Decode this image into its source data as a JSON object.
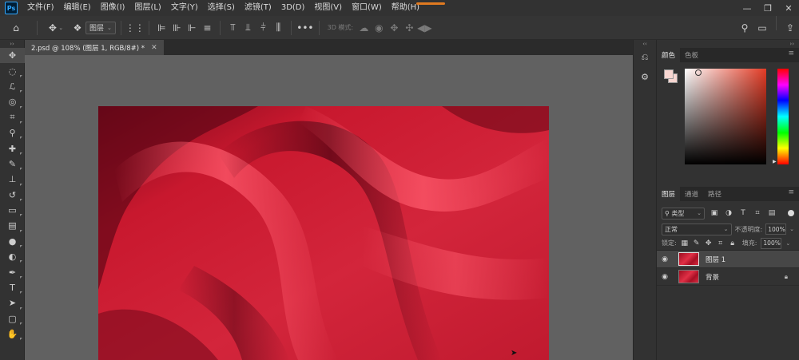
{
  "app": {
    "logo_text": "Ps"
  },
  "menu": [
    "文件(F)",
    "编辑(E)",
    "图像(I)",
    "图层(L)",
    "文字(Y)",
    "选择(S)",
    "滤镜(T)",
    "3D(D)",
    "视图(V)",
    "窗口(W)",
    "帮助(H)"
  ],
  "window_controls": {
    "minimize": "—",
    "restore": "❐",
    "close": "✕"
  },
  "options_bar": {
    "layer_select": "图层",
    "mode_3d_label": "3D 模式:"
  },
  "tools": [
    {
      "name": "move-tool",
      "glyph": "✥"
    },
    {
      "name": "marquee-tool",
      "glyph": "◌"
    },
    {
      "name": "lasso-tool",
      "glyph": "ℒ"
    },
    {
      "name": "quick-select-tool",
      "glyph": "◎"
    },
    {
      "name": "crop-tool",
      "glyph": "⌗"
    },
    {
      "name": "eyedropper-tool",
      "glyph": "⚲"
    },
    {
      "name": "healing-tool",
      "glyph": "✚"
    },
    {
      "name": "brush-tool",
      "glyph": "✎"
    },
    {
      "name": "stamp-tool",
      "glyph": "⊥"
    },
    {
      "name": "history-brush-tool",
      "glyph": "↺"
    },
    {
      "name": "eraser-tool",
      "glyph": "▭"
    },
    {
      "name": "gradient-tool",
      "glyph": "▤"
    },
    {
      "name": "blur-tool",
      "glyph": "●"
    },
    {
      "name": "dodge-tool",
      "glyph": "◐"
    },
    {
      "name": "pen-tool",
      "glyph": "✒"
    },
    {
      "name": "type-tool",
      "glyph": "T"
    },
    {
      "name": "path-select-tool",
      "glyph": "➤"
    },
    {
      "name": "shape-tool",
      "glyph": "▢"
    },
    {
      "name": "hand-tool",
      "glyph": "✋"
    }
  ],
  "document": {
    "tab_title": "2.psd @ 108% (图层 1, RGB/8#) *",
    "tab_close": "✕"
  },
  "color_panel": {
    "tabs": [
      "颜色",
      "色板"
    ],
    "foreground_color": "#f7d6d1",
    "hue_color": "#e23b25"
  },
  "layers_panel": {
    "tabs": [
      "图层",
      "通道",
      "路径"
    ],
    "filter_label": "类型",
    "blend_mode": "正常",
    "opacity_label": "不透明度:",
    "opacity_value": "100%",
    "lock_label": "锁定:",
    "fill_label": "填充:",
    "fill_value": "100%",
    "layers": [
      {
        "name": "图层 1",
        "selected": true,
        "locked": false
      },
      {
        "name": "背景",
        "selected": false,
        "locked": true
      }
    ]
  },
  "colors": {
    "fabric": "#c3172d",
    "ui_dark": "#323232",
    "canvas_bg": "#616161"
  }
}
